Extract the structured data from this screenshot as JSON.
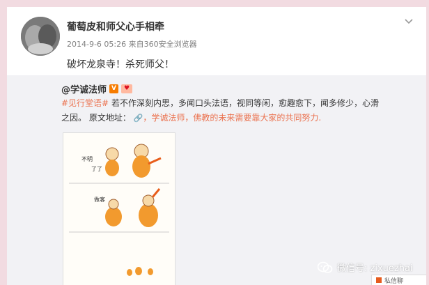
{
  "post": {
    "username": "葡萄皮和师父心手相牵",
    "timestamp": "2014-9-6 05:26",
    "source": "来自360安全浏览器",
    "text": "破坏龙泉寺！杀死师父！"
  },
  "repost": {
    "author": "@学诚法师",
    "badge_v": "V",
    "topic": "#见行堂语#",
    "text_1": " 若不作深刻内思，多闻口头法语，视同等闲，愈趣愈下，闻多修少，心滑之因。",
    "source_label": " 原文地址：",
    "link_text": "，学诚法师，佛教的未来需要靠大家的共同努力.",
    "comic_text": [
      "不明",
      "了了",
      "做客"
    ]
  },
  "watermark": {
    "label": "微信号: zixuezhai"
  },
  "corner": {
    "label": "私信聊"
  },
  "colors": {
    "background": "#f2dbe1",
    "accent": "#eb7350",
    "vbadge": "#f77c00",
    "monk_orange": "#f29a2e"
  }
}
